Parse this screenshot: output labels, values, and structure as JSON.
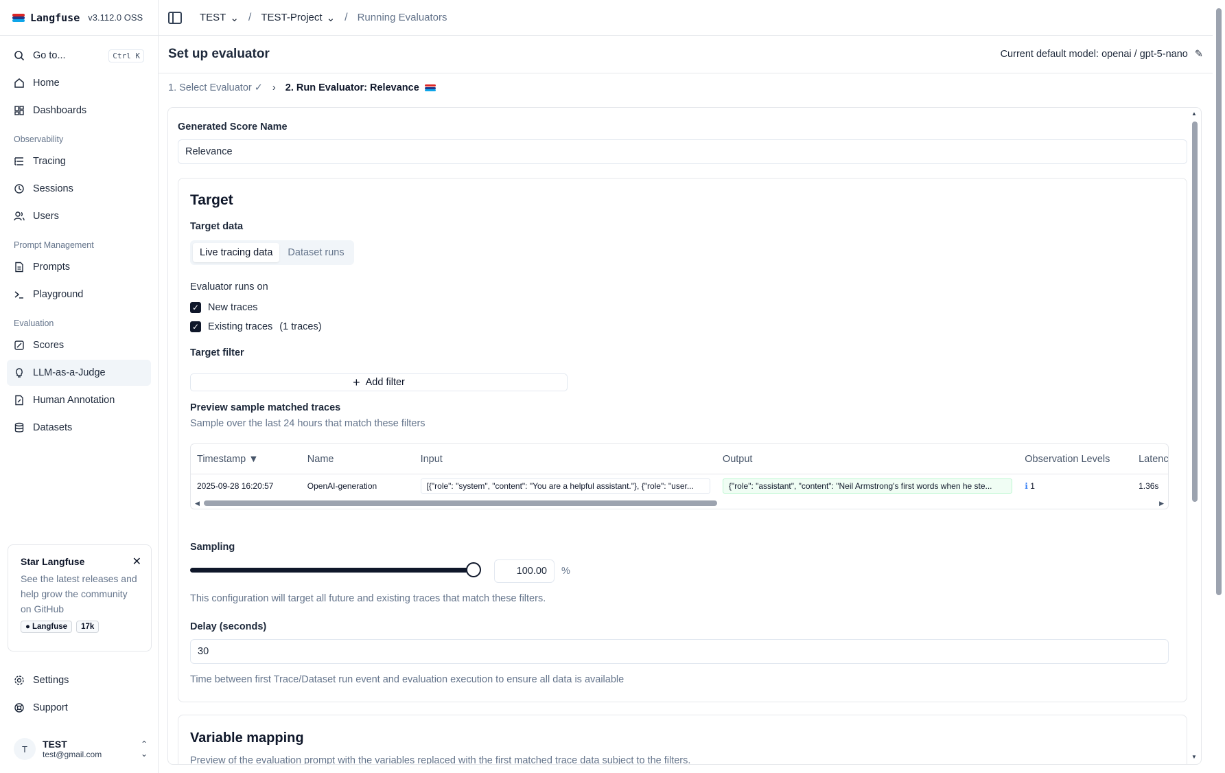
{
  "brand": {
    "name": "Langfuse",
    "version": "v3.112.0 OSS",
    "colors": [
      "#dc2626",
      "#1e3a8a",
      "#0ea5e9"
    ]
  },
  "sidebar": {
    "goto_label": "Go to...",
    "goto_shortcut": "Ctrl K",
    "items_top": [
      {
        "label": "Home",
        "icon": "home-icon"
      },
      {
        "label": "Dashboards",
        "icon": "dashboard-icon"
      }
    ],
    "observability_label": "Observability",
    "observability": [
      {
        "label": "Tracing",
        "icon": "list-tree-icon"
      },
      {
        "label": "Sessions",
        "icon": "clock-icon"
      },
      {
        "label": "Users",
        "icon": "users-icon"
      }
    ],
    "prompt_mgmt_label": "Prompt Management",
    "prompt_mgmt": [
      {
        "label": "Prompts",
        "icon": "file-text-icon"
      },
      {
        "label": "Playground",
        "icon": "terminal-icon"
      }
    ],
    "evaluation_label": "Evaluation",
    "evaluation": [
      {
        "label": "Scores",
        "icon": "square-check-icon"
      },
      {
        "label": "LLM-as-a-Judge",
        "icon": "lightbulb-icon",
        "active": true
      },
      {
        "label": "Human Annotation",
        "icon": "annotation-icon"
      },
      {
        "label": "Datasets",
        "icon": "database-icon"
      }
    ],
    "star_card": {
      "title": "Star Langfuse",
      "body": "See the latest releases and help grow the community on GitHub",
      "gh_label": "Langfuse",
      "stars": "17k"
    },
    "bottom": [
      {
        "label": "Settings",
        "icon": "gear-icon"
      },
      {
        "label": "Support",
        "icon": "lifebuoy-icon"
      }
    ],
    "user": {
      "initial": "T",
      "name": "TEST",
      "email": "test@gmail.com"
    }
  },
  "topbar": {
    "org": "TEST",
    "project": "TEST-Project",
    "page": "Running Evaluators"
  },
  "header": {
    "title": "Set up evaluator",
    "model_label": "Current default model: openai / gpt-5-nano"
  },
  "steps": {
    "step1": "1. Select Evaluator",
    "step2": "2. Run Evaluator: Relevance"
  },
  "form": {
    "score_name_label": "Generated Score Name",
    "score_name_value": "Relevance",
    "target_title": "Target",
    "target_data_label": "Target data",
    "tabs": [
      "Live tracing data",
      "Dataset runs"
    ],
    "runs_on_label": "Evaluator runs on",
    "new_traces": "New traces",
    "existing_traces": "Existing traces",
    "existing_count": "(1 traces)",
    "target_filter_label": "Target filter",
    "add_filter": "Add filter",
    "preview_title": "Preview sample matched traces",
    "preview_sub": "Sample over the last 24 hours that match these filters",
    "table": {
      "columns": [
        "Timestamp ▼",
        "Name",
        "Input",
        "Output",
        "Observation Levels",
        "Latenc"
      ],
      "rows": [
        {
          "timestamp": "2025-09-28 16:20:57",
          "name": "OpenAI-generation",
          "input": "[{\"role\": \"system\", \"content\": \"You are a helpful assistant.\"}, {\"role\": \"user...",
          "output": "{\"role\": \"assistant\", \"content\": \"Neil Armstrong's first words when he ste...",
          "levels_icon": "ℹ",
          "levels": "1",
          "latency": "1.36s"
        }
      ]
    },
    "sampling_label": "Sampling",
    "sampling_value": "100.00",
    "sampling_fraction": 1.0,
    "sampling_unit": "%",
    "sampling_note": "This configuration will target all future and existing traces that match these filters.",
    "delay_label": "Delay (seconds)",
    "delay_value": "30",
    "delay_note": "Time between first Trace/Dataset run event and evaluation execution to ensure all data is available",
    "variable_title": "Variable mapping",
    "variable_sub": "Preview of the evaluation prompt with the variables replaced with the first matched trace data subject to the filters."
  }
}
